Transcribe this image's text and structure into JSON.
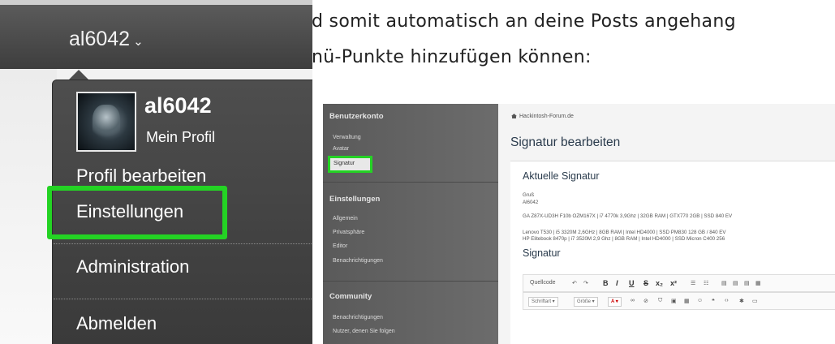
{
  "dropdown": {
    "username_toggle": "al6042",
    "chevron": "⌄",
    "profile_name": "al6042",
    "my_profile": "Mein Profil",
    "items": [
      "Profil bearbeiten",
      "Einstellungen",
      "Administration",
      "Abmelden"
    ],
    "highlight_color": "#24d324"
  },
  "article": {
    "line1": "d somit automatisch an deine Posts angehang",
    "line2": "nü-Punkte hinzufügen können:"
  },
  "screenshot": {
    "sidebar": {
      "sections": [
        {
          "title": "Benutzerkonto",
          "items": [
            "Verwaltung",
            "Avatar",
            "Signatur"
          ]
        },
        {
          "title": "Einstellungen",
          "items": [
            "Allgemein",
            "Privatsphäre",
            "Editor",
            "Benachrichtigungen"
          ]
        },
        {
          "title": "Community",
          "items": [
            "Benachrichtigungen",
            "Nutzer, denen Sie folgen"
          ]
        }
      ]
    },
    "breadcrumb": "Hackintosh-Forum.de",
    "page_title": "Signatur bearbeiten",
    "current_heading": "Aktuelle Signatur",
    "sig_lines": [
      "Gruß",
      "Al6042",
      "GA Z87X-UD3H F10b OZM167X | i7 4770k 3,9Ghz | 32GB RAM | GTX770 2GB | SSD 840 EV",
      "Lenovo T530 | i5 3320M 2,6GHz | 8GB RAM | Intel HD4000 | SSD PM830 128 GB / 840 EV",
      "HP Elitebook 8470p | i7 3520M 2,9 Ghz | 8GB RAM | Intel HD4000 | SSD Micron C400 256"
    ],
    "signature_heading": "Signatur",
    "toolbar_row1": [
      "Quellcode",
      "B",
      "I",
      "U",
      "S",
      "x₂",
      "x²"
    ],
    "toolbar_row2": [
      "Schriftart",
      "Größe",
      "A"
    ]
  }
}
